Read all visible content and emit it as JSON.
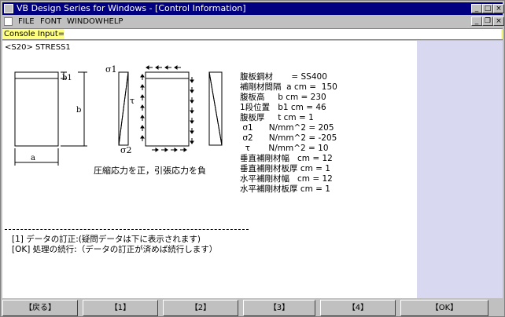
{
  "window": {
    "title": "VB Design Series for Windows - [Control Information]"
  },
  "menu": {
    "items": [
      "FILE",
      "FONT",
      "WINDOW",
      "HELP"
    ]
  },
  "console": {
    "label": "Console Input=",
    "value": ""
  },
  "screen": {
    "command": "<S20> STRESS1",
    "diagram": {
      "b1": "b1",
      "b": "b",
      "a": "a",
      "sigma1": "σ1",
      "sigma2": "σ2",
      "tau": "τ"
    },
    "note": "圧縮応力を正，引張応力を負",
    "params": [
      "腹板鋼材       = SS400",
      "補剛材間隔  a cm =  150",
      "腹板高     b cm = 230",
      "1段位置   b1 cm = 46",
      "腹板厚     t cm = 1",
      " σ1      N/mm^2 = 205",
      " σ2      N/mm^2 = -205",
      "  τ       N/mm^2 = 10",
      "垂直補剛材幅   cm = 12",
      "垂直補剛材板厚 cm = 1",
      "水平補剛材幅   cm = 12",
      "水平補剛材板厚 cm = 1"
    ],
    "options": [
      "[1] データの訂正:(疑問データは下に表示されます)",
      "[OK] 処理の続行:（データの訂正が済めば続行します）"
    ]
  },
  "function_keys": [
    "【戻る】",
    "【1】",
    "【2】",
    "【3】",
    "【4】",
    "【OK】"
  ]
}
